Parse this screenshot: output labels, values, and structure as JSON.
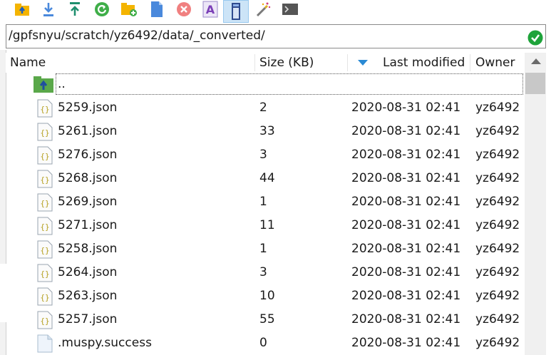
{
  "toolbar": {
    "items": [
      {
        "name": "parent-dir-icon",
        "label": ""
      },
      {
        "name": "download-icon",
        "label": ""
      },
      {
        "name": "upload-icon",
        "label": ""
      },
      {
        "name": "refresh-icon",
        "label": ""
      },
      {
        "name": "new-folder-icon",
        "label": ""
      },
      {
        "name": "new-file-icon",
        "label": ""
      },
      {
        "name": "delete-icon",
        "label": ""
      },
      {
        "name": "rename-icon",
        "label": "A"
      },
      {
        "name": "properties-icon",
        "label": ""
      },
      {
        "name": "magic-wand-icon",
        "label": ""
      },
      {
        "name": "terminal-icon",
        "label": ""
      }
    ],
    "active_item": "properties-icon"
  },
  "path": {
    "value": "/gpfsnyu/scratch/yz6492/data/_converted/",
    "status_icon": "check-circle-icon",
    "status_color": "#1ea33a"
  },
  "columns": {
    "name": "Name",
    "size": "Size (KB)",
    "modified": "Last modified",
    "owner": "Owner",
    "sort_column": "modified",
    "sort_direction": "descending"
  },
  "files": [
    {
      "name": "..",
      "size": "",
      "modified": "",
      "owner": "",
      "icon": "parent-folder-icon"
    },
    {
      "name": "5259.json",
      "size": "2",
      "modified": "2020-08-31 02:41",
      "owner": "yz6492",
      "icon": "json-file-icon"
    },
    {
      "name": "5261.json",
      "size": "33",
      "modified": "2020-08-31 02:41",
      "owner": "yz6492",
      "icon": "json-file-icon"
    },
    {
      "name": "5276.json",
      "size": "3",
      "modified": "2020-08-31 02:41",
      "owner": "yz6492",
      "icon": "json-file-icon"
    },
    {
      "name": "5268.json",
      "size": "44",
      "modified": "2020-08-31 02:41",
      "owner": "yz6492",
      "icon": "json-file-icon"
    },
    {
      "name": "5269.json",
      "size": "1",
      "modified": "2020-08-31 02:41",
      "owner": "yz6492",
      "icon": "json-file-icon"
    },
    {
      "name": "5271.json",
      "size": "11",
      "modified": "2020-08-31 02:41",
      "owner": "yz6492",
      "icon": "json-file-icon"
    },
    {
      "name": "5258.json",
      "size": "1",
      "modified": "2020-08-31 02:41",
      "owner": "yz6492",
      "icon": "json-file-icon"
    },
    {
      "name": "5264.json",
      "size": "3",
      "modified": "2020-08-31 02:41",
      "owner": "yz6492",
      "icon": "json-file-icon"
    },
    {
      "name": "5263.json",
      "size": "10",
      "modified": "2020-08-31 02:41",
      "owner": "yz6492",
      "icon": "json-file-icon"
    },
    {
      "name": "5257.json",
      "size": "55",
      "modified": "2020-08-31 02:41",
      "owner": "yz6492",
      "icon": "json-file-icon"
    },
    {
      "name": ".muspy.success",
      "size": "0",
      "modified": "2020-08-31 02:41",
      "owner": "yz6492",
      "icon": "blank-file-icon"
    }
  ],
  "selected_row": 0,
  "colors": {
    "accent": "#2a8ad4",
    "folder_green": "#5aa84a",
    "selection": "#cce4f7"
  }
}
